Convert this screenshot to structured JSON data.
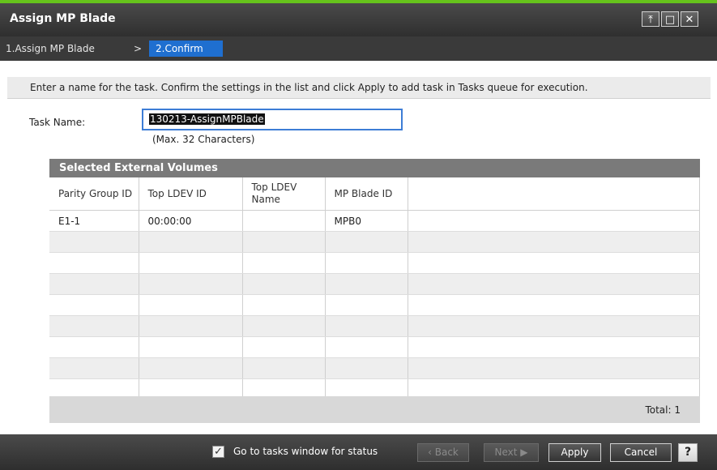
{
  "window": {
    "title": "Assign MP Blade",
    "controls": [
      "pin-icon",
      "maximize-icon",
      "close-icon"
    ]
  },
  "breadcrumb": {
    "step1": "1.Assign MP Blade",
    "separator": ">",
    "step2": "2.Confirm"
  },
  "instruction": "Enter a name for the task. Confirm the settings in the list and click Apply to add task in Tasks queue for execution.",
  "task": {
    "label": "Task Name:",
    "value": "130213-AssignMPBlade",
    "hint": "(Max. 32 Characters)"
  },
  "table": {
    "title": "Selected External Volumes",
    "headers": [
      "Parity Group ID",
      "Top LDEV ID",
      "Top LDEV Name",
      "MP Blade ID",
      ""
    ],
    "rows": [
      [
        "E1-1",
        "00:00:00",
        "",
        "MPB0",
        ""
      ]
    ],
    "total_label": "Total:",
    "total_value": "1"
  },
  "footer": {
    "checkbox_label": "Go to tasks window for status",
    "checkbox_checked": true,
    "back": "Back",
    "next": "Next",
    "apply": "Apply",
    "cancel": "Cancel",
    "help": "?"
  },
  "colors": {
    "accent_green": "#66c41c",
    "breadcrumb_active": "#1f6fd0",
    "titlebar": "#3a3a3a"
  }
}
